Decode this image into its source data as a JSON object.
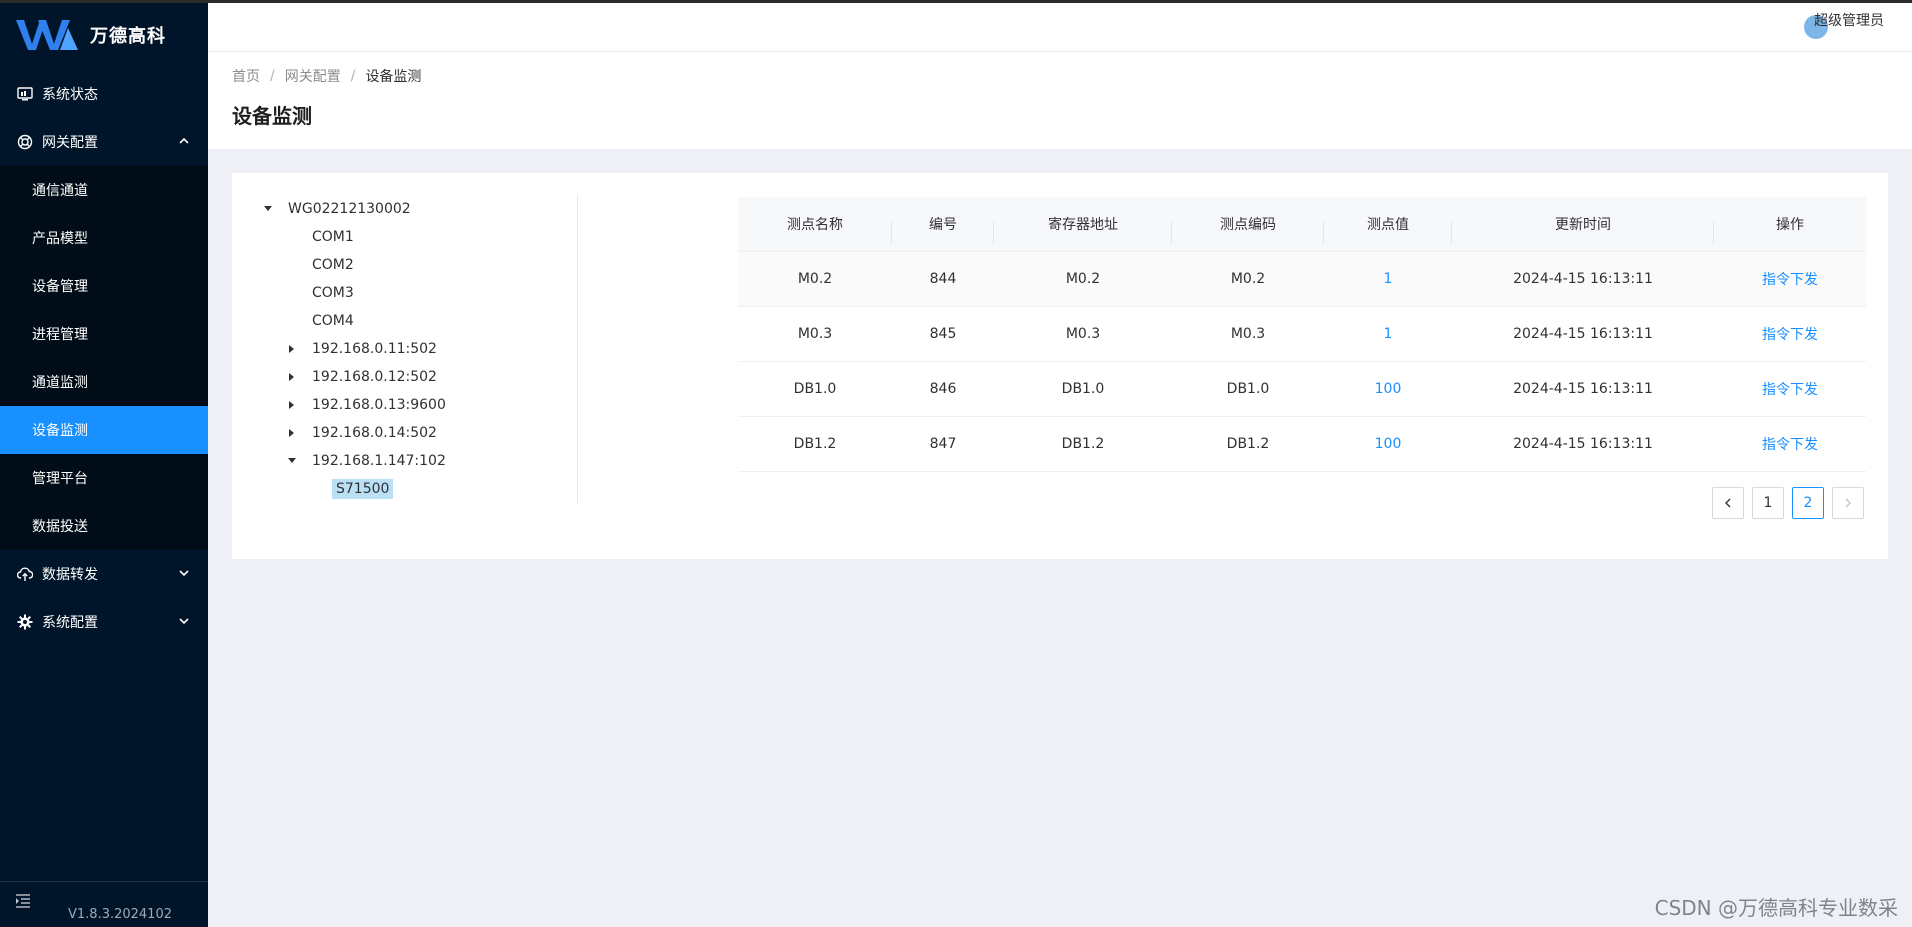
{
  "brand": {
    "name": "万德高科"
  },
  "sidebar": {
    "items": [
      {
        "label": "系统状态",
        "icon": "monitor-icon"
      },
      {
        "label": "网关配置",
        "icon": "lifebuoy-icon",
        "expanded": true,
        "children": [
          "通信通道",
          "产品模型",
          "设备管理",
          "进程管理",
          "通道监测",
          "设备监测",
          "管理平台",
          "数据投送"
        ]
      },
      {
        "label": "数据转发",
        "icon": "cloud-upload-icon"
      },
      {
        "label": "系统配置",
        "icon": "gear-icon"
      }
    ],
    "active": "设备监测",
    "version": "V1.8.3.2024102"
  },
  "header": {
    "username": "超级管理员"
  },
  "breadcrumb": {
    "home": "首页",
    "parent": "网关配置",
    "current": "设备监测"
  },
  "page": {
    "title": "设备监测"
  },
  "tree": {
    "root": "WG02212130002",
    "ports": [
      "COM1",
      "COM2",
      "COM3",
      "COM4"
    ],
    "ips": [
      "192.168.0.11:502",
      "192.168.0.12:502",
      "192.168.0.13:9600",
      "192.168.0.14:502"
    ],
    "expanded_ip": "192.168.1.147:102",
    "selected_leaf": "S71500"
  },
  "table": {
    "headers": [
      "测点名称",
      "编号",
      "寄存器地址",
      "测点编码",
      "测点值",
      "更新时间",
      "操作"
    ],
    "rows": [
      [
        "M0.2",
        "844",
        "M0.2",
        "M0.2",
        "1",
        "2024-4-15 16:13:11",
        "指令下发"
      ],
      [
        "M0.3",
        "845",
        "M0.3",
        "M0.3",
        "1",
        "2024-4-15 16:13:11",
        "指令下发"
      ],
      [
        "DB1.0",
        "846",
        "DB1.0",
        "DB1.0",
        "100",
        "2024-4-15 16:13:11",
        "指令下发"
      ],
      [
        "DB1.2",
        "847",
        "DB1.2",
        "DB1.2",
        "100",
        "2024-4-15 16:13:11",
        "指令下发"
      ]
    ]
  },
  "pagination": {
    "prev": "<",
    "pages": [
      "1",
      "2"
    ],
    "current": "2",
    "next": ">"
  },
  "watermark": "CSDN @万德高科专业数采",
  "colors": {
    "sidebar_bg": "#001529",
    "submenu_bg": "#000c17",
    "accent": "#1890ff",
    "selected_node": "#bae0f5"
  }
}
